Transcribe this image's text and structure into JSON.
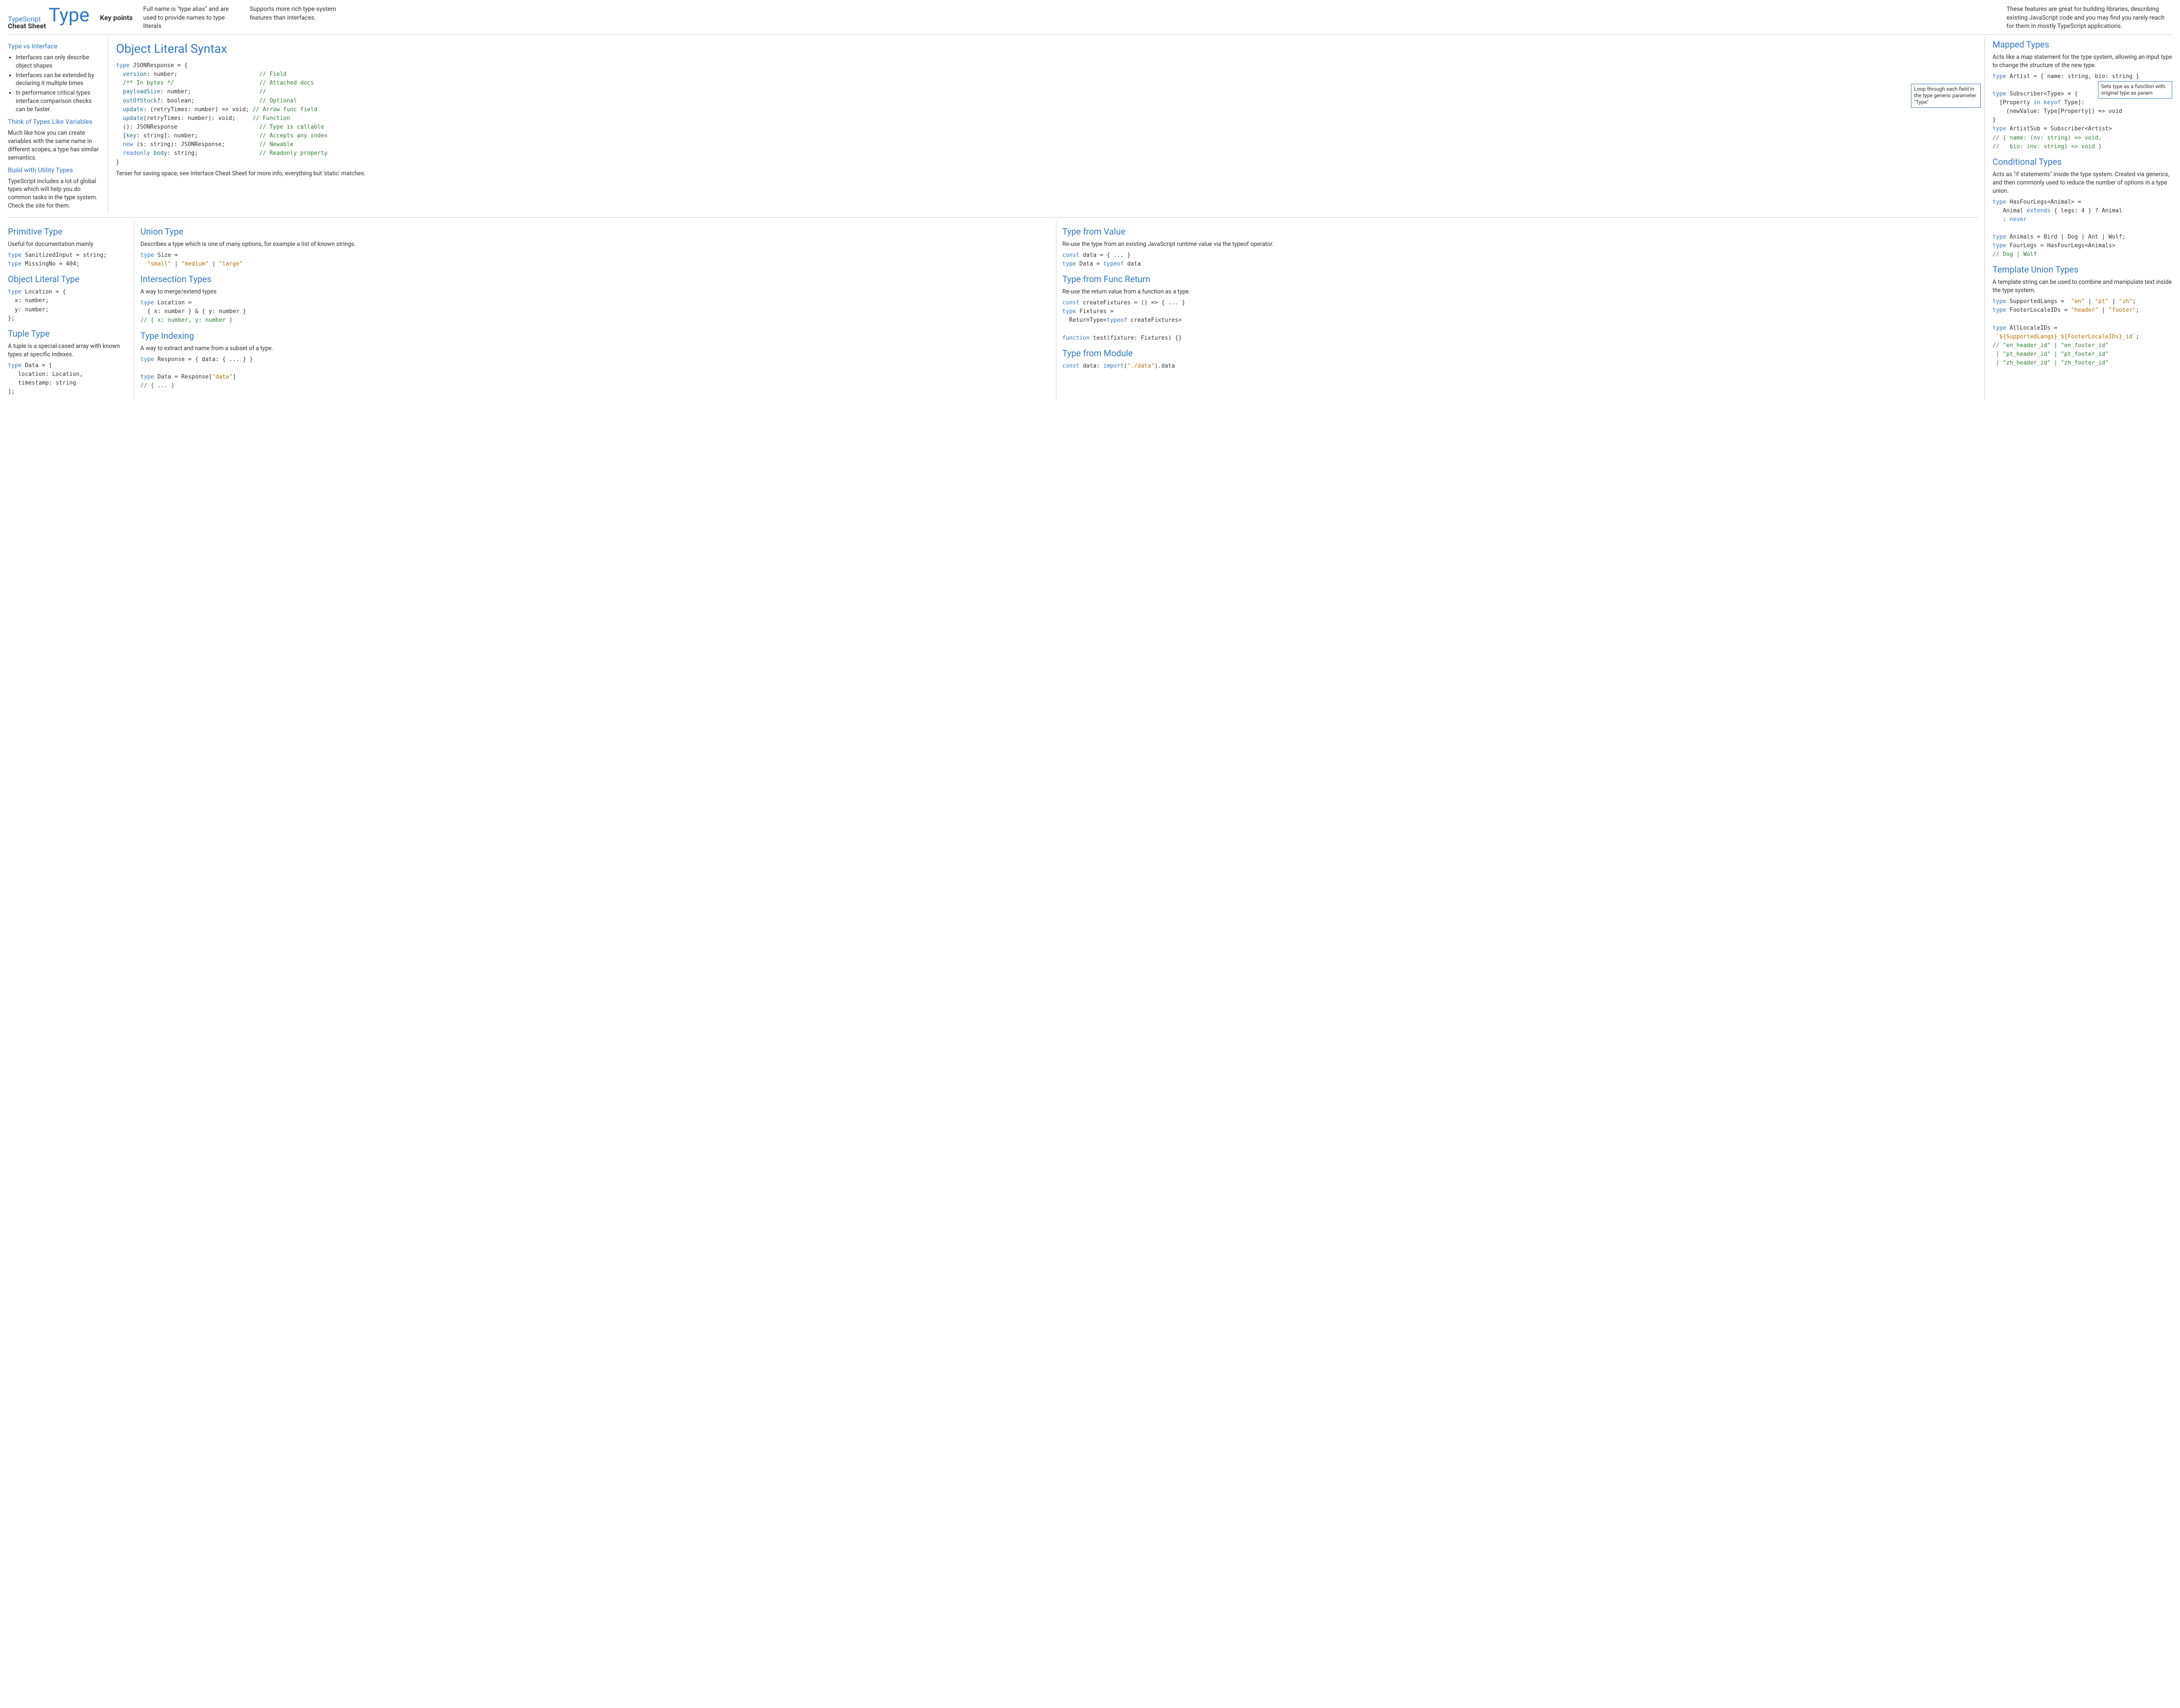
{
  "header": {
    "brand_line1": "TypeScript",
    "brand_line2": "Cheat Sheet",
    "brand_big": "Type",
    "key_points_label": "Key points",
    "kp1": "Full name is \"type alias\" and are used to provide names to type literals",
    "kp2": "Supports more rich type-system features than interfaces.",
    "feature_note": "These features are great for building libraries, describing existing JavaScript code and you may find you rarely reach for them in mostly TypeScript applications."
  },
  "left": {
    "tvi_title": "Type vs Interface",
    "tvi_b1": "Interfaces can only describe object shapes",
    "tvi_b2": "Interfaces can be extended by declaring it multiple times",
    "tvi_b3": "In performance critical types interface comparison checks can be faster.",
    "vars_title": "Think of Types Like Variables",
    "vars_body": "Much like how you can create variables with the same name in different scopes, a type has similar semantics.",
    "util_title": "Build with Utility Types",
    "util_body": "TypeScript includes a lot of global types which will help you do common tasks in the type system. Check the site for them."
  },
  "ols": {
    "title": "Object Literal Syntax",
    "callout1": "Loop through each field in the type generic parameter \"Type\"",
    "callout2": "Sets type as a function with original type as param",
    "footer": "Terser for saving space, see Interface Cheat Sheet for more info, everything but 'static' matches."
  },
  "prim": {
    "title": "Primitive Type",
    "note": "Useful for documentation mainly"
  },
  "objlit": {
    "title": "Object Literal Type"
  },
  "tuple": {
    "title": "Tuple Type",
    "note": "A tuple is a special-cased array with known types at specific indexes."
  },
  "union": {
    "title": "Union Type",
    "note": "Describes a type which is one of many options, for example a list of known strings."
  },
  "inter": {
    "title": "Intersection Types",
    "note": "A way to merge/extend types"
  },
  "index": {
    "title": "Type Indexing",
    "note": "A way to extract and name from a subset of a type."
  },
  "tfv": {
    "title": "Type from Value",
    "note": "Re-use the type from an existing JavaScript runtime value via the typeof operator."
  },
  "tfr": {
    "title": "Type from Func Return",
    "note": "Re-use the return value from a function as a type."
  },
  "tfm": {
    "title": "Type from Module"
  },
  "mapped": {
    "title": "Mapped Types",
    "note": "Acts like a map statement for the type system, allowing an input type to change the structure of the new type."
  },
  "cond": {
    "title": "Conditional Types",
    "note": "Acts as \"if statements\"  inside the type system. Created via generics, and then commonly used to reduce the number of options in a type union."
  },
  "tmpl": {
    "title": "Template Union Types",
    "note": "A template string can be used to combine and manipulate text inside the type system."
  }
}
